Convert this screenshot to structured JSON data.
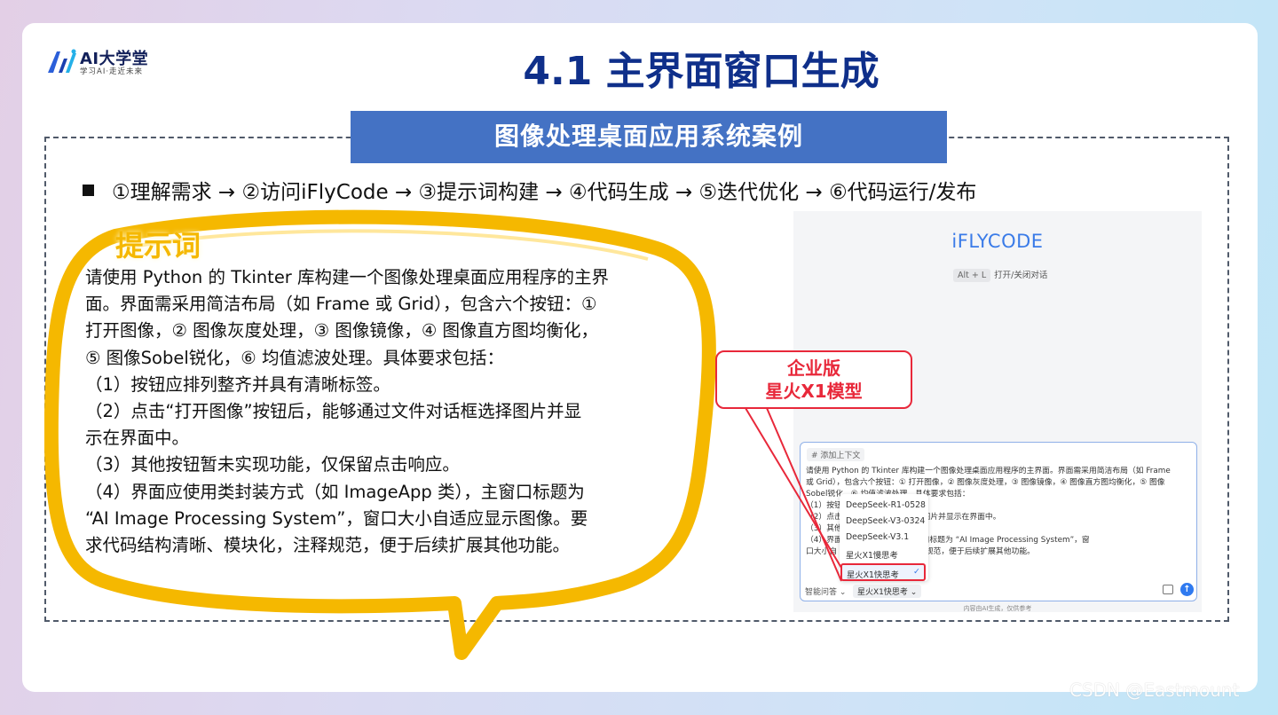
{
  "logo": {
    "name": "AI大学堂",
    "tagline": "学习AI·走近未来",
    "icon": "ai-university-logo"
  },
  "title": "4.1 主界面窗口生成",
  "banner": "图像处理桌面应用系统案例",
  "steps": "①理解需求 → ②访问iFlyCode → ③提示词构建 → ④代码生成 → ⑤迭代优化 → ⑥代码运行/发布",
  "prompt": {
    "tag": "提示词",
    "lines": [
      "请使用 Python 的 Tkinter 库构建一个图像处理桌面应用程序的主界",
      "面。界面需采用简洁布局（如 Frame 或 Grid），包含六个按钮：①",
      "打开图像，② 图像灰度处理，③ 图像镜像，④ 图像直方图均衡化，",
      "⑤ 图像Sobel锐化，⑥ 均值滤波处理。具体要求包括：",
      "（1）按钮应排列整齐并具有清晰标签。",
      "（2）点击“打开图像”按钮后，能够通过文件对话框选择图片并显",
      "示在界面中。",
      "（3）其他按钮暂未实现功能，仅保留点击响应。",
      "（4）界面应使用类封装方式（如 ImageApp 类），主窗口标题为",
      "“AI Image Processing System”，窗口大小自适应显示图像。要",
      "求代码结构清晰、模块化，注释规范，便于后续扩展其他功能。"
    ]
  },
  "iflycode": {
    "brand": "iFLYCODE",
    "shortcut_key": "Alt + L",
    "shortcut_text": "打开/关闭对话",
    "context_label": "# 添加上下文",
    "input_lines": [
      "请使用 Python 的 Tkinter 库构建一个图像处理桌面应用程序的主界面。界面需采用简洁布局（如 Frame",
      "或 Grid），包含六个按钮：① 打开图像，② 图像灰度处理，③ 图像镜像，④ 图像直方图均衡化，⑤ 图像",
      "Sobel锐化，⑥ 均值滤波处理。具体要求包括：",
      "（1）按钮                     标签。",
      "（2）点击                     够通过文件对话框选择图片并显示在界面中。",
      "（3）其他                     保留点击响应。",
      "（4）界面                     ImageApp 类），主窗口标题为 “AI Image Processing System”，窗",
      "口大小自                      结构清晰、模块化，注释规范，便于后续扩展其他功能。"
    ],
    "mode_label": "智能问答",
    "model_label": "星火X1快思考",
    "disclaimer": "内容由AI生成，仅供参考",
    "model_options": [
      "DeepSeek-R1-0528",
      "DeepSeek-V3-0324",
      "DeepSeek-V3.1",
      "星火X1慢思考"
    ],
    "selected_option": "星火X1快思考"
  },
  "callout": {
    "line1": "企业版",
    "line2": "星火X1模型"
  },
  "watermark": "CSDN @Eastmount",
  "colors": {
    "title": "#0f2f8a",
    "banner": "#4472c4",
    "bubble": "#f5b800",
    "callout": "#e8283a",
    "brand": "#3a7be8"
  }
}
